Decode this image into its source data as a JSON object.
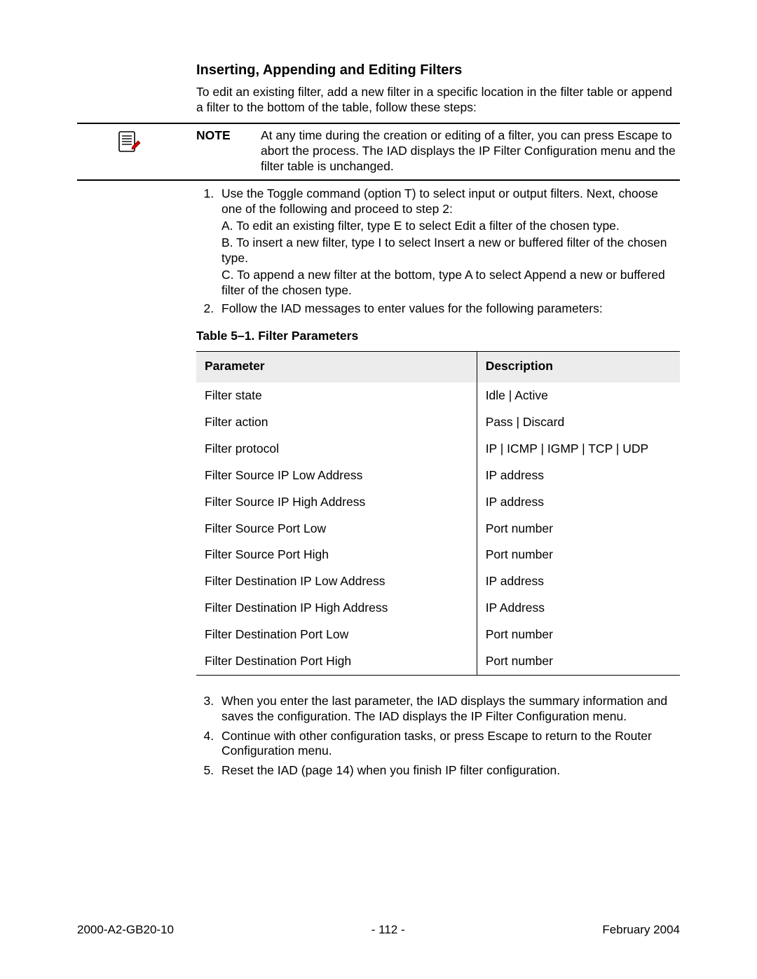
{
  "section_title": "Inserting, Appending and Editing Filters",
  "intro": "To edit an existing filter, add a new filter in a specific location in the filter table or append a filter to the bottom of the table, follow these steps:",
  "note_label": "NOTE",
  "note_text": "At any time during the creation or editing of a filter, you can press Escape to abort the process. The IAD displays the IP Filter Configuration menu and the filter table is unchanged.",
  "steps_top": {
    "1_lead": "Use the Toggle command (option T) to select input or output filters. Next, choose one of the following and proceed to step 2:",
    "1a": "A. To edit an existing filter, type E to select Edit a filter of the chosen type.",
    "1b": "B. To insert a new filter, type I  to select Insert a new or buffered filter of the chosen type.",
    "1c": "C. To append a new filter at the bottom, type A to select Append a new or buffered filter of the chosen type.",
    "2": "Follow the IAD messages to enter values for the following parameters:"
  },
  "table_caption": "Table 5–1.   Filter Parameters",
  "table_headers": {
    "p": "Parameter",
    "d": "Description"
  },
  "table_rows": [
    {
      "p": "Filter state",
      "d": "Idle | Active"
    },
    {
      "p": "Filter action",
      "d": "Pass | Discard"
    },
    {
      "p": "Filter protocol",
      "d": "IP | ICMP | IGMP | TCP | UDP"
    },
    {
      "p": "Filter Source IP Low Address",
      "d": "IP address"
    },
    {
      "p": "Filter Source IP High Address",
      "d": "IP address"
    },
    {
      "p": "Filter Source Port Low",
      "d": "Port number"
    },
    {
      "p": "Filter Source Port High",
      "d": "Port number"
    },
    {
      "p": "Filter Destination IP Low Address",
      "d": "IP address"
    },
    {
      "p": "Filter Destination IP High Address",
      "d": "IP Address"
    },
    {
      "p": "Filter Destination Port Low",
      "d": "Port number"
    },
    {
      "p": "Filter Destination Port High",
      "d": "Port number"
    }
  ],
  "steps_bottom": {
    "3": "When you enter the last parameter, the IAD displays the summary information and saves the configuration. The IAD displays the IP Filter Configuration menu.",
    "4": "Continue with other configuration tasks, or press Escape to return to the Router Configuration menu.",
    "5": "Reset the IAD (page 14) when you finish IP filter configuration."
  },
  "footer": {
    "left": "2000-A2-GB20-10",
    "center": "- 112 -",
    "right": "February 2004"
  }
}
